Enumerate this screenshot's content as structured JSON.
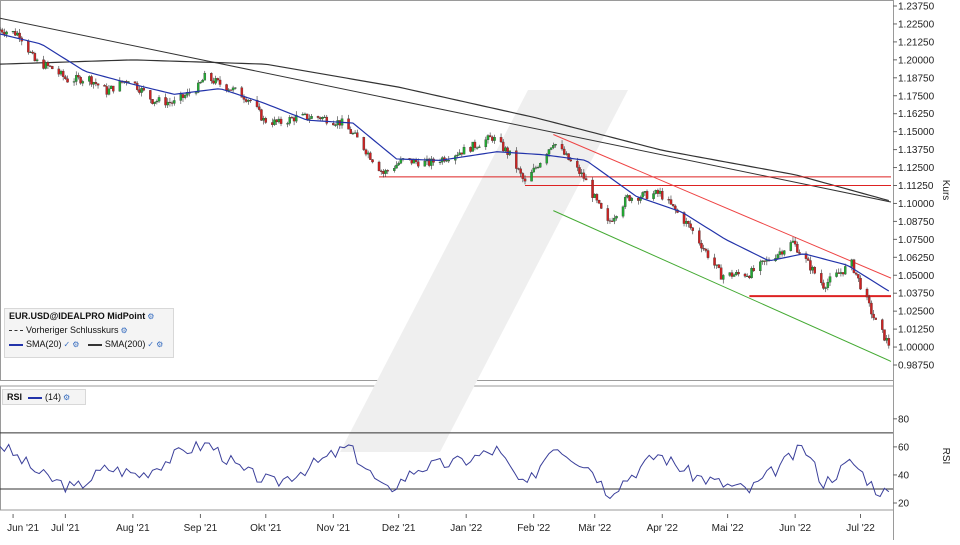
{
  "chart_data": [
    {
      "type": "candlestick",
      "instrument": "EUR.USD@IDEALPRO MidPoint",
      "ylabel": "Kurs",
      "ylim": [
        0.9875,
        1.2375
      ],
      "yticks": [
        "1.23750",
        "1.22500",
        "1.21250",
        "1.20000",
        "1.18750",
        "1.17500",
        "1.16250",
        "1.15000",
        "1.13750",
        "1.12500",
        "1.11250",
        "1.10000",
        "1.08750",
        "1.07500",
        "1.06250",
        "1.05000",
        "1.03750",
        "1.02500",
        "1.01250",
        "1.00000",
        "0.98750"
      ],
      "xticks": [
        "Jun '21",
        "Jul '21",
        "Aug '21",
        "Sep '21",
        "Okt '21",
        "Nov '21",
        "Dez '21",
        "Jan '22",
        "Feb '22",
        "Mär '22",
        "Apr '22",
        "Mai '22",
        "Jun '22",
        "Jul '22"
      ],
      "x_start": "2021-06-01",
      "x_end": "2022-07-15",
      "close_path": [
        [
          "2021-06-01",
          1.221
        ],
        [
          "2021-06-10",
          1.218
        ],
        [
          "2021-06-17",
          1.199
        ],
        [
          "2021-06-25",
          1.194
        ],
        [
          "2021-07-02",
          1.186
        ],
        [
          "2021-07-12",
          1.187
        ],
        [
          "2021-07-20",
          1.178
        ],
        [
          "2021-07-30",
          1.187
        ],
        [
          "2021-08-10",
          1.172
        ],
        [
          "2021-08-20",
          1.17
        ],
        [
          "2021-08-31",
          1.181
        ],
        [
          "2021-09-03",
          1.188
        ],
        [
          "2021-09-15",
          1.18
        ],
        [
          "2021-09-24",
          1.172
        ],
        [
          "2021-09-30",
          1.158
        ],
        [
          "2021-10-07",
          1.156
        ],
        [
          "2021-10-15",
          1.16
        ],
        [
          "2021-10-26",
          1.16
        ],
        [
          "2021-11-05",
          1.156
        ],
        [
          "2021-11-12",
          1.145
        ],
        [
          "2021-11-24",
          1.121
        ],
        [
          "2021-12-03",
          1.13
        ],
        [
          "2021-12-15",
          1.128
        ],
        [
          "2021-12-31",
          1.137
        ],
        [
          "2022-01-13",
          1.146
        ],
        [
          "2022-01-21",
          1.134
        ],
        [
          "2022-01-28",
          1.114
        ],
        [
          "2022-02-10",
          1.143
        ],
        [
          "2022-02-24",
          1.118
        ],
        [
          "2022-03-07",
          1.086
        ],
        [
          "2022-03-16",
          1.104
        ],
        [
          "2022-03-31",
          1.107
        ],
        [
          "2022-04-14",
          1.083
        ],
        [
          "2022-04-28",
          1.05
        ],
        [
          "2022-05-11",
          1.051
        ],
        [
          "2022-05-31",
          1.073
        ],
        [
          "2022-06-14",
          1.043
        ],
        [
          "2022-06-27",
          1.058
        ],
        [
          "2022-07-08",
          1.017
        ],
        [
          "2022-07-14",
          1.002
        ]
      ],
      "series": [
        {
          "name": "Vorheriger Schlusskurs"
        },
        {
          "name": "SMA(20)",
          "color": "#2233aa"
        },
        {
          "name": "SMA(200)",
          "color": "#333333"
        }
      ],
      "sma20_path": [
        [
          "2021-06-01",
          1.218
        ],
        [
          "2021-06-20",
          1.211
        ],
        [
          "2021-07-10",
          1.192
        ],
        [
          "2021-08-01",
          1.183
        ],
        [
          "2021-08-20",
          1.176
        ],
        [
          "2021-09-10",
          1.18
        ],
        [
          "2021-09-30",
          1.17
        ],
        [
          "2021-10-20",
          1.158
        ],
        [
          "2021-11-10",
          1.156
        ],
        [
          "2021-11-30",
          1.131
        ],
        [
          "2021-12-20",
          1.13
        ],
        [
          "2022-01-15",
          1.136
        ],
        [
          "2022-02-05",
          1.134
        ],
        [
          "2022-02-25",
          1.13
        ],
        [
          "2022-03-20",
          1.105
        ],
        [
          "2022-04-10",
          1.094
        ],
        [
          "2022-04-30",
          1.075
        ],
        [
          "2022-05-20",
          1.06
        ],
        [
          "2022-06-05",
          1.065
        ],
        [
          "2022-06-25",
          1.057
        ],
        [
          "2022-07-14",
          1.039
        ]
      ],
      "sma200_path": [
        [
          "2021-06-01",
          1.197
        ],
        [
          "2021-08-01",
          1.2
        ],
        [
          "2021-10-01",
          1.197
        ],
        [
          "2021-12-01",
          1.181
        ],
        [
          "2022-02-01",
          1.16
        ],
        [
          "2022-04-01",
          1.137
        ],
        [
          "2022-06-01",
          1.12
        ],
        [
          "2022-07-14",
          1.102
        ]
      ],
      "support_lines": [
        {
          "from": "2021-11-22",
          "to": "2022-07-15",
          "y": 1.1185,
          "color": "#dd2222"
        },
        {
          "from": "2022-01-28",
          "to": "2022-07-15",
          "y": 1.1125,
          "color": "#dd2222"
        },
        {
          "from": "2022-05-11",
          "to": "2022-07-15",
          "y": 1.0355,
          "color": "#dd2222"
        }
      ],
      "trend_channel": [
        {
          "from": [
            "2022-02-10",
            1.148
          ],
          "to": [
            "2022-07-15",
            1.048
          ],
          "color": "#ee4444"
        },
        {
          "from": [
            "2022-02-10",
            1.095
          ],
          "to": [
            "2022-07-15",
            0.99
          ],
          "color": "#44aa33"
        }
      ]
    },
    {
      "type": "line",
      "name": "RSI",
      "period_label": "(14)",
      "ylabel": "RSI",
      "ylim": [
        15,
        92
      ],
      "yticks": [
        "80",
        "60",
        "40",
        "20"
      ],
      "levels": [
        70,
        30
      ],
      "values_path": [
        [
          "2021-06-01",
          62
        ],
        [
          "2021-06-20",
          40
        ],
        [
          "2021-07-05",
          30
        ],
        [
          "2021-07-20",
          45
        ],
        [
          "2021-08-05",
          40
        ],
        [
          "2021-08-25",
          58
        ],
        [
          "2021-09-05",
          62
        ],
        [
          "2021-09-20",
          43
        ],
        [
          "2021-10-05",
          34
        ],
        [
          "2021-10-20",
          45
        ],
        [
          "2021-11-08",
          60
        ],
        [
          "2021-11-25",
          28
        ],
        [
          "2021-12-10",
          45
        ],
        [
          "2021-12-31",
          50
        ],
        [
          "2022-01-15",
          58
        ],
        [
          "2022-01-28",
          30
        ],
        [
          "2022-02-10",
          62
        ],
        [
          "2022-02-28",
          44
        ],
        [
          "2022-03-07",
          27
        ],
        [
          "2022-03-30",
          55
        ],
        [
          "2022-04-15",
          40
        ],
        [
          "2022-04-30",
          33
        ],
        [
          "2022-05-11",
          29
        ],
        [
          "2022-06-05",
          60
        ],
        [
          "2022-06-14",
          34
        ],
        [
          "2022-06-27",
          50
        ],
        [
          "2022-07-08",
          30
        ],
        [
          "2022-07-14",
          27
        ]
      ]
    }
  ],
  "legend": {
    "title": "EUR.USD@IDEALPRO MidPoint",
    "prev_close": "Vorheriger Schlusskurs",
    "sma20": "SMA(20)",
    "sma200": "SMA(200)"
  },
  "rsi_legend": {
    "name": "RSI",
    "period": "(14)"
  }
}
